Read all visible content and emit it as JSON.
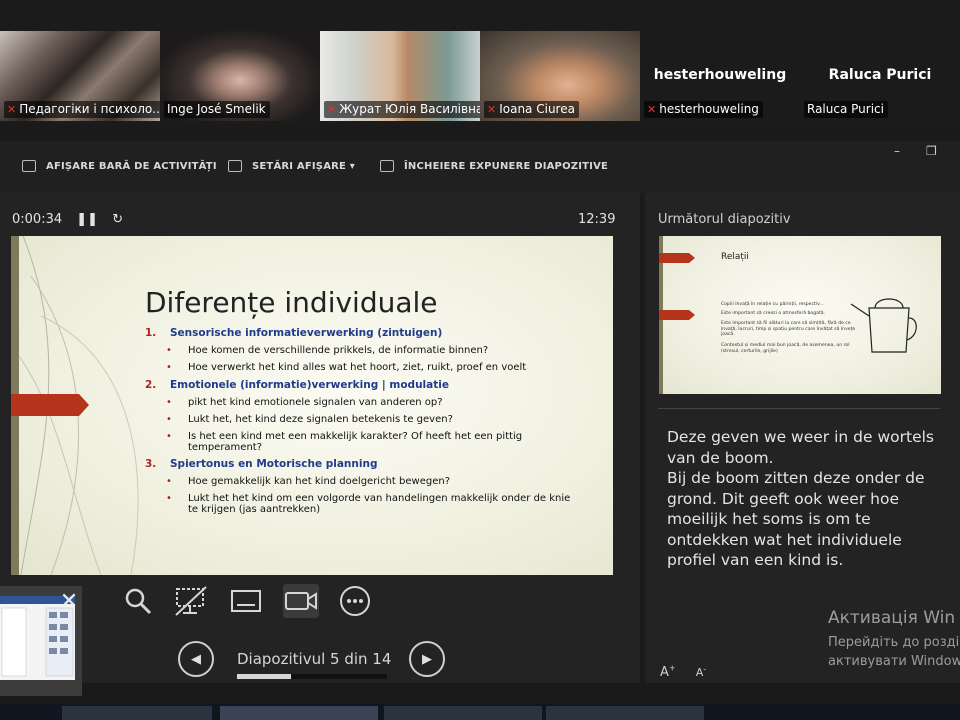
{
  "participants": [
    {
      "name": "Педагогіки і психоло...",
      "muted": true
    },
    {
      "name": "Inge José Smelik",
      "muted": false,
      "active": true
    },
    {
      "name": "Журат Юлія Василівна",
      "muted": true
    },
    {
      "name": "Ioana Ciurea",
      "muted": true
    },
    {
      "name": "hesterhouweling",
      "display": "hesterhouweling",
      "muted": true
    },
    {
      "name": "Raluca Purici",
      "display": "Raluca Purici",
      "muted": false
    }
  ],
  "toolbar": {
    "taskbar": "AFIȘARE BARĂ DE ACTIVITĂȚI",
    "display_settings": "SETĂRI AFIȘARE ▾",
    "end_show": "ÎNCHEIERE EXPUNERE DIAPOZITIVE"
  },
  "timer": "0:00:34",
  "clock": "12:39",
  "slide": {
    "title": "Diferențe individuale",
    "sections": [
      {
        "num": "1.",
        "heading": "Sensorische informatieverwerking (zintuigen)",
        "bullets": [
          "Hoe komen de verschillende prikkels, de informatie binnen?",
          "Hoe verwerkt het kind alles wat het hoort, ziet, ruikt, proef en voelt"
        ]
      },
      {
        "num": "2.",
        "heading": "Emotionele (informatie)verwerking | modulatie",
        "bullets": [
          "pikt het kind emotionele signalen van anderen op?",
          "Lukt het, het kind deze signalen betekenis te geven?",
          "Is het een kind met een makkelijk karakter? Of heeft het een pittig temperament?"
        ]
      },
      {
        "num": "3.",
        "heading": "Spiertonus en Motorische planning",
        "bullets": [
          "Hoe gemakkelijk kan het kind doelgericht bewegen?",
          "Lukt het het kind om een volgorde van handelingen makkelijk onder de knie te krijgen (jas aantrekken)"
        ]
      }
    ]
  },
  "navigation": {
    "slide_counter": "Diapozitivul 5 din 14",
    "current": 5,
    "total": 14
  },
  "next": {
    "label": "Următorul diapozitiv",
    "title": "Relații",
    "bullets": [
      "Copiii învață în relație cu părinții, respectiv...",
      "Este important să creezi o atmosferă bogată.",
      "Este important să fii alături la care să simțită, fără de ce învață, lucruri, timp și spațiu pentru care învățat să învețe joacă.",
      "Contextul și mediul mai bun joacă, de asemenea, un rol (stresul, certurile, grijile)"
    ]
  },
  "notes": "Deze geven we weer in de wortels van de boom.\nBij de boom zitten deze onder de grond. Dit geeft ook weer hoe moeilijk het soms is om te ontdekken wat het individuele profiel van een kind is.",
  "windows_activation": {
    "title": "Активація Win",
    "line1": "Перейдіть до розді",
    "line2": "активувати Window"
  },
  "colors": {
    "accent_green": "#23d160",
    "muted_red": "#e0342c",
    "slide_heading": "#1f3b8c",
    "slide_number": "#b22020"
  }
}
